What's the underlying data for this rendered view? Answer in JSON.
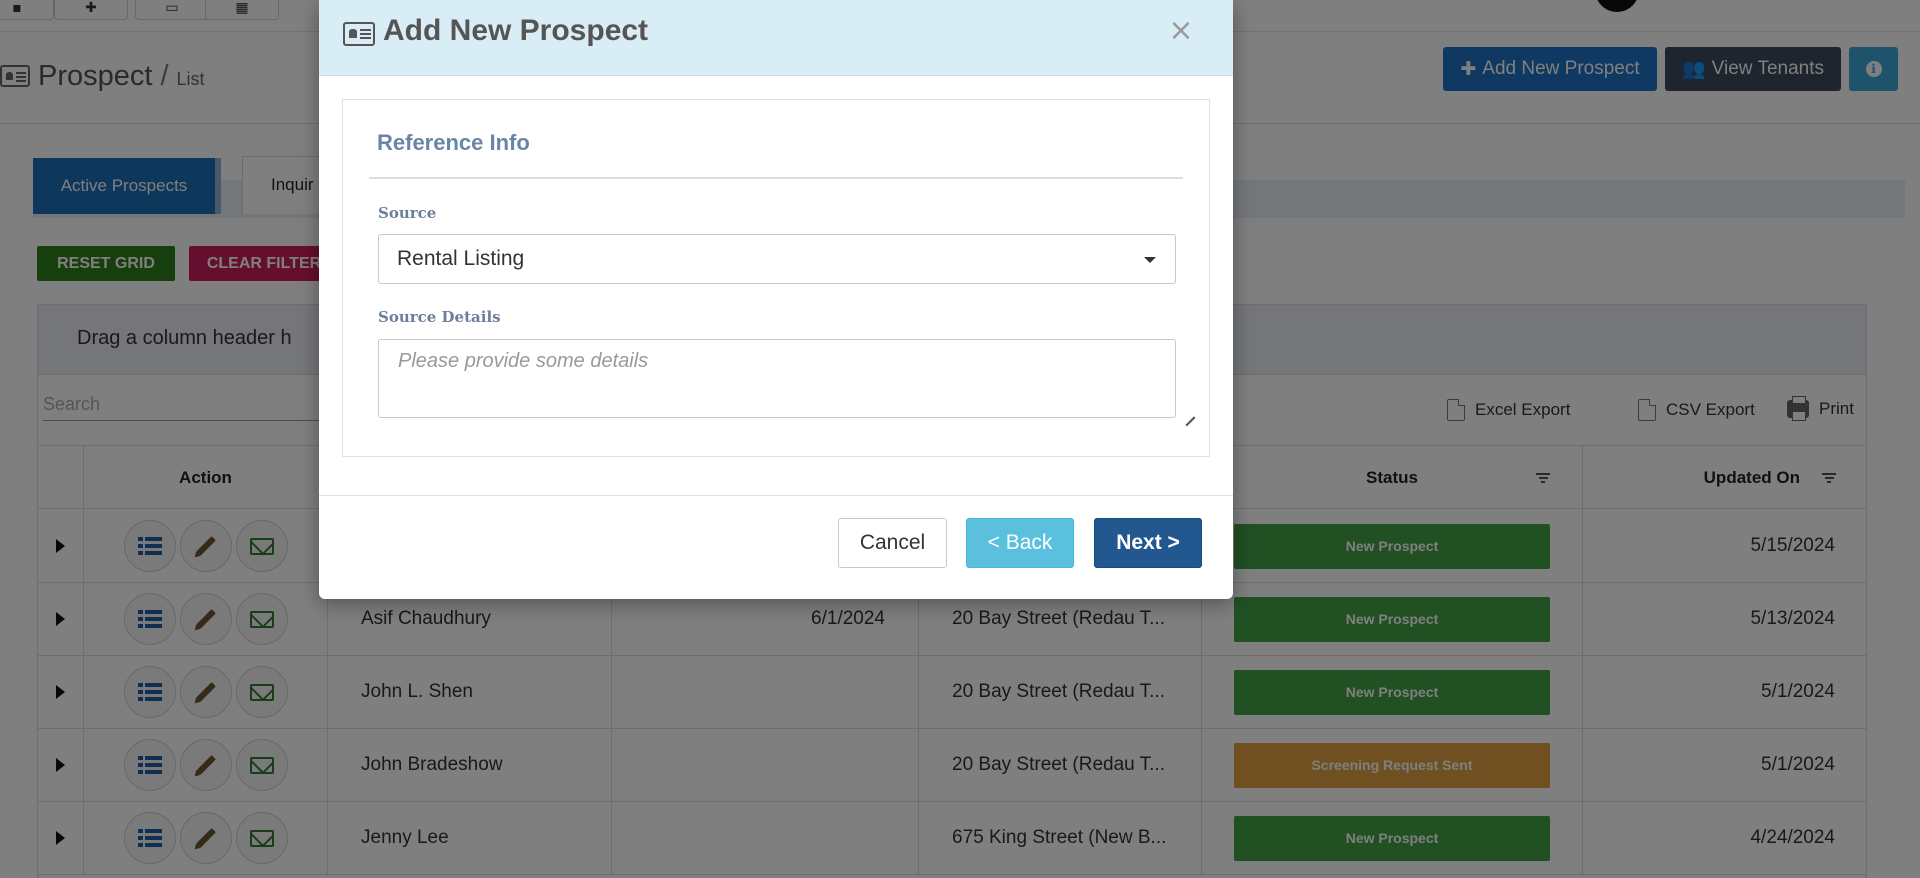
{
  "page": {
    "title": "Prospect",
    "separator": "/",
    "subtitle": "List",
    "buttons": {
      "add_prospect": "Add New Prospect",
      "view_tenants": "View Tenants"
    }
  },
  "tabs": [
    {
      "label": "Active Prospects",
      "active": true
    },
    {
      "label": "Inquir",
      "active": false
    }
  ],
  "grid": {
    "reset_label": "RESET GRID",
    "clear_label": "CLEAR FILTER",
    "group_hint": "Drag a column header h",
    "search_placeholder": "Search",
    "excel_export": "Excel Export",
    "csv_export": "CSV Export",
    "print": "Print",
    "columns": {
      "action": "Action",
      "status": "Status",
      "updated_on": "Updated On"
    },
    "rows": [
      {
        "name": "",
        "date": "",
        "property": "",
        "status": "New Prospect",
        "status_color": "#43a047",
        "updated": "5/15/2024"
      },
      {
        "name": "Asif Chaudhury",
        "date": "6/1/2024",
        "property": "20 Bay Street (Redau T...",
        "status": "New Prospect",
        "status_color": "#43a047",
        "updated": "5/13/2024"
      },
      {
        "name": "John L. Shen",
        "date": "",
        "property": "20 Bay Street (Redau T...",
        "status": "New Prospect",
        "status_color": "#43a047",
        "updated": "5/1/2024"
      },
      {
        "name": "John Bradeshow",
        "date": "",
        "property": "20 Bay Street (Redau T...",
        "status": "Screening Request Sent",
        "status_color": "#e0a040",
        "updated": "5/1/2024"
      },
      {
        "name": "Jenny Lee",
        "date": "",
        "property": "675 King Street (New B...",
        "status": "New Prospect",
        "status_color": "#43a047",
        "updated": "4/24/2024"
      }
    ]
  },
  "modal": {
    "title": "Add New Prospect",
    "close_glyph": "×",
    "section_title": "Reference Info",
    "source_label": "Source",
    "source_value": "Rental Listing",
    "details_label": "Source Details",
    "details_placeholder": "Please provide some details",
    "cancel_label": "Cancel",
    "back_label": "< Back",
    "next_label": "Next >"
  },
  "colors": {
    "primary": "#1f72c4",
    "header_bg": "#d9edf7",
    "next_button": "#22588f",
    "back_button": "#5bc0de",
    "new_prospect": "#43a047",
    "screening": "#e0a040"
  },
  "icons": {
    "modal_header": "id-card-icon",
    "close": "close-icon",
    "source_dropdown": "caret-down-icon"
  }
}
